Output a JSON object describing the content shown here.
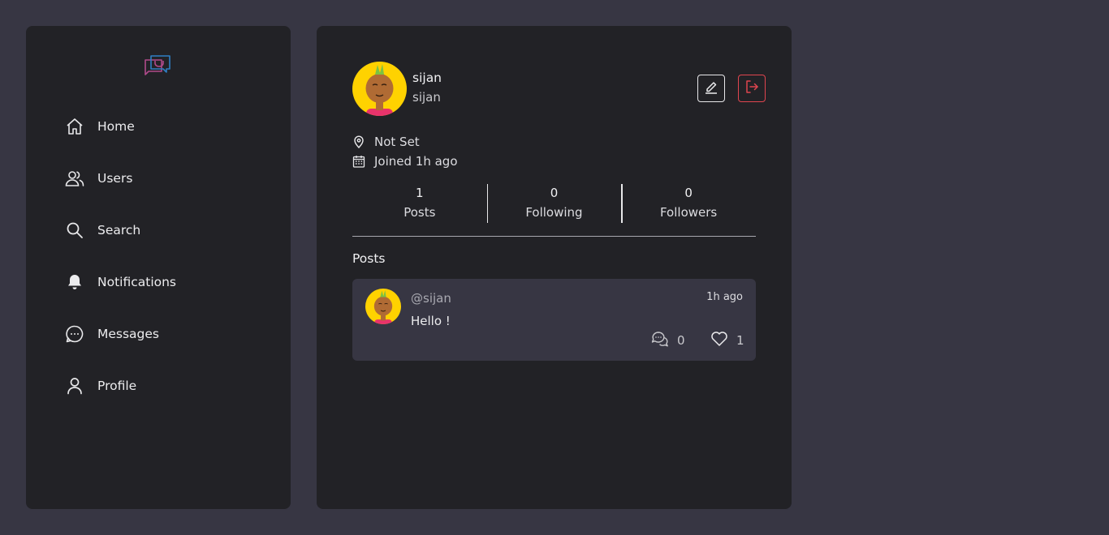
{
  "sidebar": {
    "items": [
      {
        "label": "Home",
        "icon": "home-icon"
      },
      {
        "label": "Users",
        "icon": "users-icon"
      },
      {
        "label": "Search",
        "icon": "search-icon"
      },
      {
        "label": "Notifications",
        "icon": "bell-icon"
      },
      {
        "label": "Messages",
        "icon": "chat-bubble-icon"
      },
      {
        "label": "Profile",
        "icon": "user-icon"
      }
    ]
  },
  "profile": {
    "name": "sijan",
    "username": "sijan",
    "location": "Not Set",
    "joined": "Joined 1h ago",
    "stats": [
      {
        "count": "1",
        "label": "Posts"
      },
      {
        "count": "0",
        "label": "Following"
      },
      {
        "count": "0",
        "label": "Followers"
      }
    ]
  },
  "posts_section": {
    "title": "Posts",
    "items": [
      {
        "user": "@sijan",
        "time": "1h ago",
        "text": "Hello !",
        "comments": "0",
        "likes": "1"
      }
    ]
  },
  "colors": {
    "background": "#373643",
    "panel": "#222226",
    "card": "#373643",
    "logout_accent": "#e0454f",
    "avatar_bg": "#ffd200"
  }
}
